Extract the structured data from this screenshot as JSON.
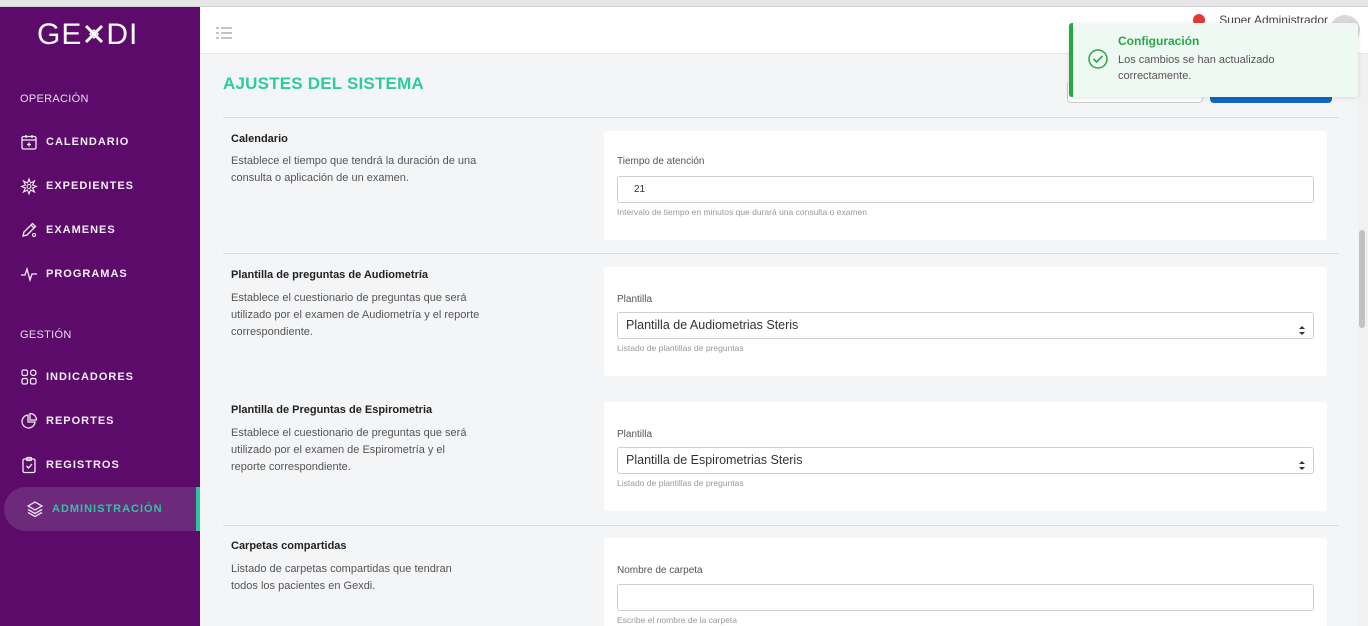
{
  "app": {
    "logo_text_left": "GE",
    "logo_text_right": "DI"
  },
  "user": {
    "name": "Super Administrador"
  },
  "sidebar": {
    "sections": [
      {
        "label": "OPERACIÓN"
      },
      {
        "label": "GESTIÓN"
      }
    ],
    "items": [
      {
        "label": "CALENDARIO",
        "icon": "calendar-icon"
      },
      {
        "label": "EXPEDIENTES",
        "icon": "medical-icon"
      },
      {
        "label": "EXAMENES",
        "icon": "pencil-icon"
      },
      {
        "label": "PROGRAMAS",
        "icon": "pulse-icon"
      },
      {
        "label": "INDICADORES",
        "icon": "grid-icon"
      },
      {
        "label": "REPORTES",
        "icon": "pie-chart-icon"
      },
      {
        "label": "REGISTROS",
        "icon": "clipboard-icon"
      },
      {
        "label": "ADMINISTRACIÓN",
        "icon": "layers-icon",
        "active": true
      }
    ]
  },
  "page": {
    "title": "AJUSTES DEL SISTEMA"
  },
  "settings": [
    {
      "title": "Calendario",
      "description": "Establece el tiempo que tendrá la duración de una consulta o aplicación de un examen.",
      "field_label": "Tiempo de atención",
      "value": "21",
      "help": "Intervalo de tiempo en minutos que durará una consulta o examen"
    },
    {
      "title": "Plantilla de preguntas de Audiometría",
      "description": "Establece el cuestionario de preguntas que será utilizado por el examen de Audiometría y el reporte correspondiente.",
      "field_label": "Plantilla",
      "value": "Plantilla de Audiometrias Steris",
      "help": "Listado de plantillas de preguntas"
    },
    {
      "title": "Plantilla de Preguntas de Espirometria",
      "description": "Establece el cuestionario de preguntas que será utilizado por el examen de Espirometría y el reporte correspondiente.",
      "field_label": "Plantilla",
      "value": "Plantilla de Espirometrias Steris",
      "help": "Listado de plantillas de preguntas"
    },
    {
      "title": "Carpetas compartidas",
      "description": "Listado de carpetas compartidas que tendran todos los pacientes en Gexdi.",
      "field_label": "Nombre de carpeta",
      "value": "",
      "help": "Escribe el nombre de la carpeta"
    }
  ],
  "toast": {
    "title": "Configuración",
    "message": "Los cambios se han actualizado correctamente."
  },
  "colors": {
    "sidebar": "#5c0b6b",
    "accent": "#2ecc9a",
    "primary": "#1565c0",
    "success": "#28a745"
  }
}
